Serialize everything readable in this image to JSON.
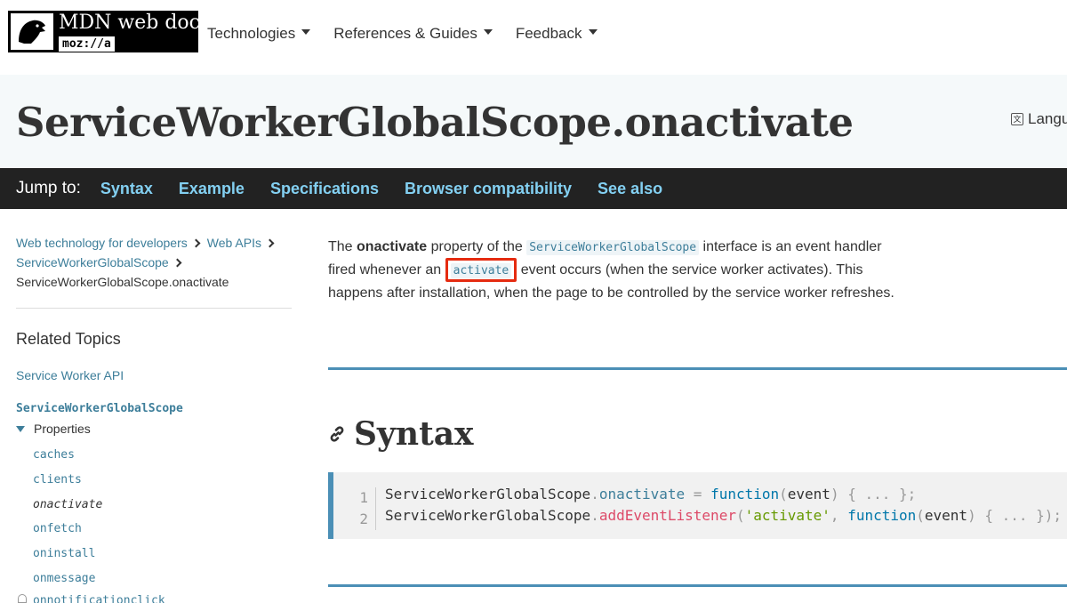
{
  "header": {
    "logo_title": "MDN web docs",
    "logo_sub": "moz://a",
    "nav": [
      "Technologies",
      "References & Guides",
      "Feedback"
    ]
  },
  "page": {
    "title": "ServiceWorkerGlobalScope.onactivate",
    "language_label": "Langu"
  },
  "jumpbar": {
    "label": "Jump to:",
    "links": [
      "Syntax",
      "Example",
      "Specifications",
      "Browser compatibility",
      "See also"
    ]
  },
  "sidebar": {
    "breadcrumbs": [
      "Web technology for developers",
      "Web APIs",
      "ServiceWorkerGlobalScope",
      "ServiceWorkerGlobalScope.onactivate"
    ],
    "related_title": "Related Topics",
    "api_link": "Service Worker API",
    "interface_link": "ServiceWorkerGlobalScope",
    "properties_label": "Properties",
    "properties": [
      "caches",
      "clients",
      "onactivate",
      "onfetch",
      "oninstall",
      "onmessage"
    ],
    "cut_item": "onnotificationclick",
    "current_property": "onactivate"
  },
  "content": {
    "intro": {
      "t1": "The ",
      "bold": "onactivate",
      "t2": " property of the ",
      "code1": "ServiceWorkerGlobalScope",
      "t3": " interface is an event handler fired whenever an ",
      "code2": "activate",
      "t4": " event occurs (when the service worker activates). This happens after installation, when the page to be controlled by the service worker refreshes."
    },
    "syntax_heading": "Syntax",
    "code": {
      "line_numbers": [
        "1",
        "2"
      ],
      "l1": {
        "obj": "ServiceWorkerGlobalScope",
        "dot": ".",
        "prop": "onactivate",
        "eq": " = ",
        "kw": "function",
        "p1": "(",
        "arg": "event",
        "p2": ")",
        "rest": " { ... };"
      },
      "l2": {
        "obj": "ServiceWorkerGlobalScope",
        "dot": ".",
        "method": "addEventListener",
        "p1": "(",
        "str": "'activate'",
        "comma": ", ",
        "kw": "function",
        "p2": "(",
        "arg": "event",
        "p3": ")",
        "rest": " { ... });"
      }
    }
  },
  "colors": {
    "link": "#3d7e9a",
    "jump_link": "#83d0f2",
    "highlight": "#e52b10",
    "rule": "#4b8fb6"
  }
}
